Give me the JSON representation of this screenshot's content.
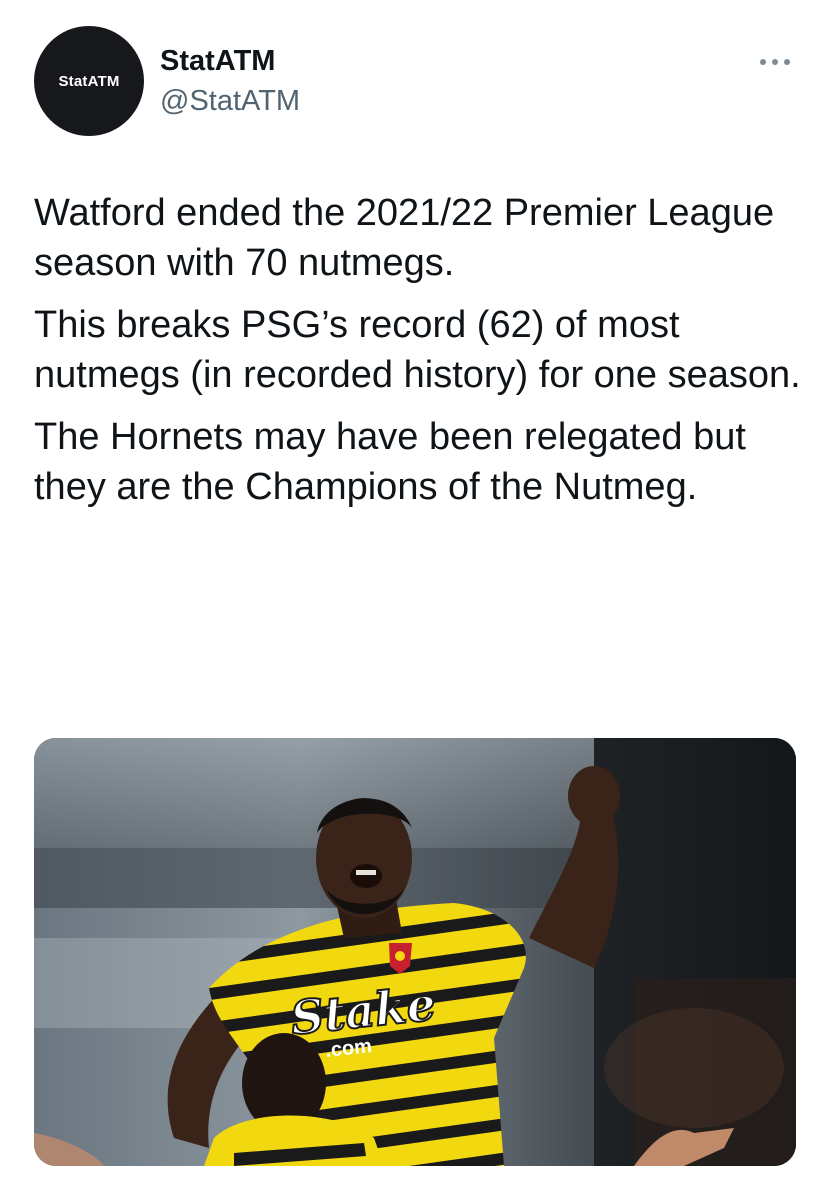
{
  "author": {
    "avatar_text": "StatATM",
    "display_name": "StatATM",
    "handle": "@StatATM"
  },
  "more_icon": "more-horizontal-icon",
  "tweet": {
    "paragraphs": [
      "Watford ended the 2021/22 Premier League season with 70 nutmegs.",
      "This breaks PSG’s record (62) of most nutmegs (in recorded history) for one season.",
      "The Hornets may have been relegated but they are the Champions of the Nutmeg."
    ]
  },
  "media": {
    "shirt_sponsor": "Stake",
    "shirt_sponsor_sub": ".com"
  },
  "colors": {
    "text": "#0f1419",
    "secondary": "#536471",
    "avatar_bg": "#16181c",
    "kit_yellow": "#f2d80f",
    "kit_black": "#1a1a1a"
  }
}
